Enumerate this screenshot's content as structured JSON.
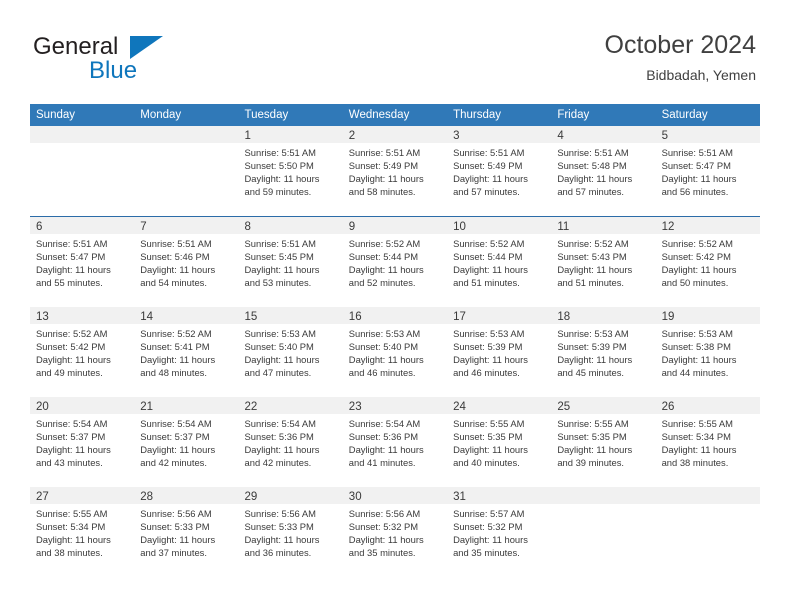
{
  "logo": {
    "word_one": "General",
    "word_two": "Blue",
    "triangle_icon": "triangle-icon",
    "brand_color": "#0f76bc",
    "text_color": "#231f20"
  },
  "header": {
    "title": "October 2024",
    "subtitle": "Bidbadah, Yemen"
  },
  "theme": {
    "header_bg": "#3079b8",
    "header_text": "#ffffff",
    "row_divider": "#2b6ca8",
    "day_band_bg": "#f1f1f1",
    "body_text": "#3a3a3a"
  },
  "weekdays": [
    "Sunday",
    "Monday",
    "Tuesday",
    "Wednesday",
    "Thursday",
    "Friday",
    "Saturday"
  ],
  "weeks": [
    [
      {
        "day": "",
        "lines": []
      },
      {
        "day": "",
        "lines": []
      },
      {
        "day": "1",
        "lines": [
          "Sunrise: 5:51 AM",
          "Sunset: 5:50 PM",
          "Daylight: 11 hours",
          "and 59 minutes."
        ]
      },
      {
        "day": "2",
        "lines": [
          "Sunrise: 5:51 AM",
          "Sunset: 5:49 PM",
          "Daylight: 11 hours",
          "and 58 minutes."
        ]
      },
      {
        "day": "3",
        "lines": [
          "Sunrise: 5:51 AM",
          "Sunset: 5:49 PM",
          "Daylight: 11 hours",
          "and 57 minutes."
        ]
      },
      {
        "day": "4",
        "lines": [
          "Sunrise: 5:51 AM",
          "Sunset: 5:48 PM",
          "Daylight: 11 hours",
          "and 57 minutes."
        ]
      },
      {
        "day": "5",
        "lines": [
          "Sunrise: 5:51 AM",
          "Sunset: 5:47 PM",
          "Daylight: 11 hours",
          "and 56 minutes."
        ]
      }
    ],
    [
      {
        "day": "6",
        "lines": [
          "Sunrise: 5:51 AM",
          "Sunset: 5:47 PM",
          "Daylight: 11 hours",
          "and 55 minutes."
        ]
      },
      {
        "day": "7",
        "lines": [
          "Sunrise: 5:51 AM",
          "Sunset: 5:46 PM",
          "Daylight: 11 hours",
          "and 54 minutes."
        ]
      },
      {
        "day": "8",
        "lines": [
          "Sunrise: 5:51 AM",
          "Sunset: 5:45 PM",
          "Daylight: 11 hours",
          "and 53 minutes."
        ]
      },
      {
        "day": "9",
        "lines": [
          "Sunrise: 5:52 AM",
          "Sunset: 5:44 PM",
          "Daylight: 11 hours",
          "and 52 minutes."
        ]
      },
      {
        "day": "10",
        "lines": [
          "Sunrise: 5:52 AM",
          "Sunset: 5:44 PM",
          "Daylight: 11 hours",
          "and 51 minutes."
        ]
      },
      {
        "day": "11",
        "lines": [
          "Sunrise: 5:52 AM",
          "Sunset: 5:43 PM",
          "Daylight: 11 hours",
          "and 51 minutes."
        ]
      },
      {
        "day": "12",
        "lines": [
          "Sunrise: 5:52 AM",
          "Sunset: 5:42 PM",
          "Daylight: 11 hours",
          "and 50 minutes."
        ]
      }
    ],
    [
      {
        "day": "13",
        "lines": [
          "Sunrise: 5:52 AM",
          "Sunset: 5:42 PM",
          "Daylight: 11 hours",
          "and 49 minutes."
        ]
      },
      {
        "day": "14",
        "lines": [
          "Sunrise: 5:52 AM",
          "Sunset: 5:41 PM",
          "Daylight: 11 hours",
          "and 48 minutes."
        ]
      },
      {
        "day": "15",
        "lines": [
          "Sunrise: 5:53 AM",
          "Sunset: 5:40 PM",
          "Daylight: 11 hours",
          "and 47 minutes."
        ]
      },
      {
        "day": "16",
        "lines": [
          "Sunrise: 5:53 AM",
          "Sunset: 5:40 PM",
          "Daylight: 11 hours",
          "and 46 minutes."
        ]
      },
      {
        "day": "17",
        "lines": [
          "Sunrise: 5:53 AM",
          "Sunset: 5:39 PM",
          "Daylight: 11 hours",
          "and 46 minutes."
        ]
      },
      {
        "day": "18",
        "lines": [
          "Sunrise: 5:53 AM",
          "Sunset: 5:39 PM",
          "Daylight: 11 hours",
          "and 45 minutes."
        ]
      },
      {
        "day": "19",
        "lines": [
          "Sunrise: 5:53 AM",
          "Sunset: 5:38 PM",
          "Daylight: 11 hours",
          "and 44 minutes."
        ]
      }
    ],
    [
      {
        "day": "20",
        "lines": [
          "Sunrise: 5:54 AM",
          "Sunset: 5:37 PM",
          "Daylight: 11 hours",
          "and 43 minutes."
        ]
      },
      {
        "day": "21",
        "lines": [
          "Sunrise: 5:54 AM",
          "Sunset: 5:37 PM",
          "Daylight: 11 hours",
          "and 42 minutes."
        ]
      },
      {
        "day": "22",
        "lines": [
          "Sunrise: 5:54 AM",
          "Sunset: 5:36 PM",
          "Daylight: 11 hours",
          "and 42 minutes."
        ]
      },
      {
        "day": "23",
        "lines": [
          "Sunrise: 5:54 AM",
          "Sunset: 5:36 PM",
          "Daylight: 11 hours",
          "and 41 minutes."
        ]
      },
      {
        "day": "24",
        "lines": [
          "Sunrise: 5:55 AM",
          "Sunset: 5:35 PM",
          "Daylight: 11 hours",
          "and 40 minutes."
        ]
      },
      {
        "day": "25",
        "lines": [
          "Sunrise: 5:55 AM",
          "Sunset: 5:35 PM",
          "Daylight: 11 hours",
          "and 39 minutes."
        ]
      },
      {
        "day": "26",
        "lines": [
          "Sunrise: 5:55 AM",
          "Sunset: 5:34 PM",
          "Daylight: 11 hours",
          "and 38 minutes."
        ]
      }
    ],
    [
      {
        "day": "27",
        "lines": [
          "Sunrise: 5:55 AM",
          "Sunset: 5:34 PM",
          "Daylight: 11 hours",
          "and 38 minutes."
        ]
      },
      {
        "day": "28",
        "lines": [
          "Sunrise: 5:56 AM",
          "Sunset: 5:33 PM",
          "Daylight: 11 hours",
          "and 37 minutes."
        ]
      },
      {
        "day": "29",
        "lines": [
          "Sunrise: 5:56 AM",
          "Sunset: 5:33 PM",
          "Daylight: 11 hours",
          "and 36 minutes."
        ]
      },
      {
        "day": "30",
        "lines": [
          "Sunrise: 5:56 AM",
          "Sunset: 5:32 PM",
          "Daylight: 11 hours",
          "and 35 minutes."
        ]
      },
      {
        "day": "31",
        "lines": [
          "Sunrise: 5:57 AM",
          "Sunset: 5:32 PM",
          "Daylight: 11 hours",
          "and 35 minutes."
        ]
      },
      {
        "day": "",
        "lines": []
      },
      {
        "day": "",
        "lines": []
      }
    ]
  ]
}
